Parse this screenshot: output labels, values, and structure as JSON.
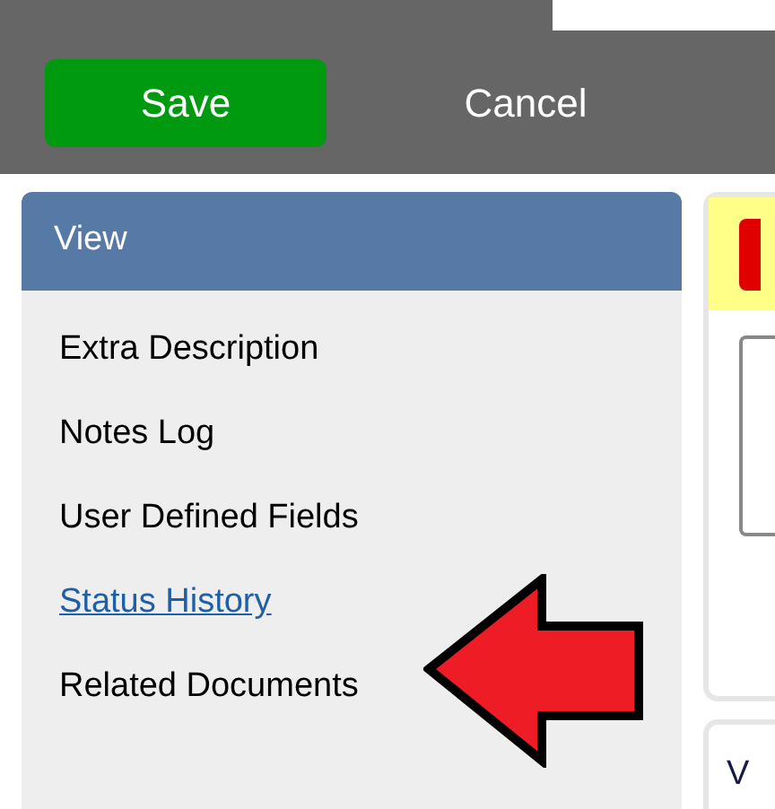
{
  "toolbar": {
    "buttons": [
      {
        "label": "Save",
        "kind": "primary"
      },
      {
        "label": "Cancel",
        "kind": "plain"
      }
    ]
  },
  "view_panel": {
    "title": "View",
    "items": [
      {
        "label": "Extra Description",
        "kind": "text"
      },
      {
        "label": "Notes Log",
        "kind": "text"
      },
      {
        "label": "User Defined Fields",
        "kind": "text"
      },
      {
        "label": "Status History",
        "kind": "link"
      },
      {
        "label": "Related Documents",
        "kind": "text"
      }
    ]
  },
  "right_panel": {
    "lower_heading": "V"
  }
}
